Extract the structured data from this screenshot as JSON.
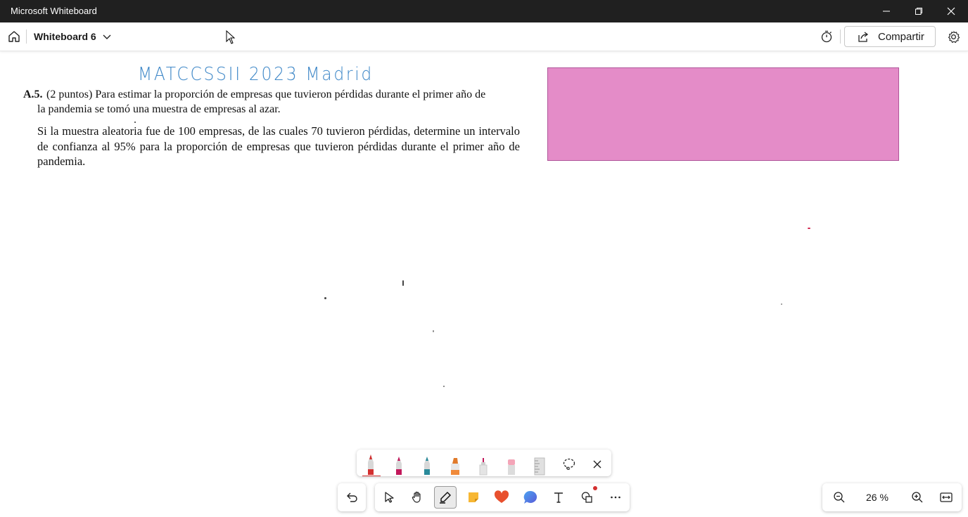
{
  "window": {
    "title": "Microsoft Whiteboard",
    "controls": [
      "minimize-icon",
      "restore-icon",
      "close-icon"
    ]
  },
  "topbar": {
    "board_name": "Whiteboard 6",
    "share_label": "Compartir",
    "icons": [
      "home-icon",
      "chevron-down-icon",
      "timer-icon",
      "share-icon",
      "settings-icon"
    ]
  },
  "canvas": {
    "handwriting": "MATCCSSII  2023  Madrid",
    "problem": {
      "number": "A.5.",
      "line1": "(2 puntos) Para estimar la proporción de empresas que tuvieron pérdidas durante el primer año de",
      "line2": "la pandemia se tomó una muestra de empresas al azar.",
      "paragraph": "Si la muestra aleatoria fue de 100 empresas, de las cuales 70 tuvieron pérdidas, determine un intervalo de confianza al 95% para la proporción de empresas que tuvieron pérdidas durante el primer año de pandemia."
    },
    "shape_color": "#e48cc8"
  },
  "pen_tray": {
    "items": [
      "red-pen-icon",
      "magenta-pen-icon",
      "teal-pen-icon",
      "orange-highlighter-icon",
      "glue-pen-icon",
      "eraser-icon",
      "ruler-icon",
      "lasso-icon",
      "close-icon"
    ]
  },
  "toolbar": {
    "items": [
      "undo-icon",
      "select-icon",
      "pan-hand-icon",
      "inking-pen-icon",
      "sticky-note-icon",
      "reactions-heart-icon",
      "comment-icon",
      "text-icon",
      "shapes-icon",
      "more-icon"
    ]
  },
  "zoom": {
    "value": "26 %",
    "icons": [
      "zoom-out-icon",
      "zoom-in-icon",
      "fit-to-screen-icon"
    ]
  },
  "colors": {
    "accent_red": "#d32f2f",
    "handwriting_blue": "#3f88c8",
    "titlebar": "#202020"
  }
}
